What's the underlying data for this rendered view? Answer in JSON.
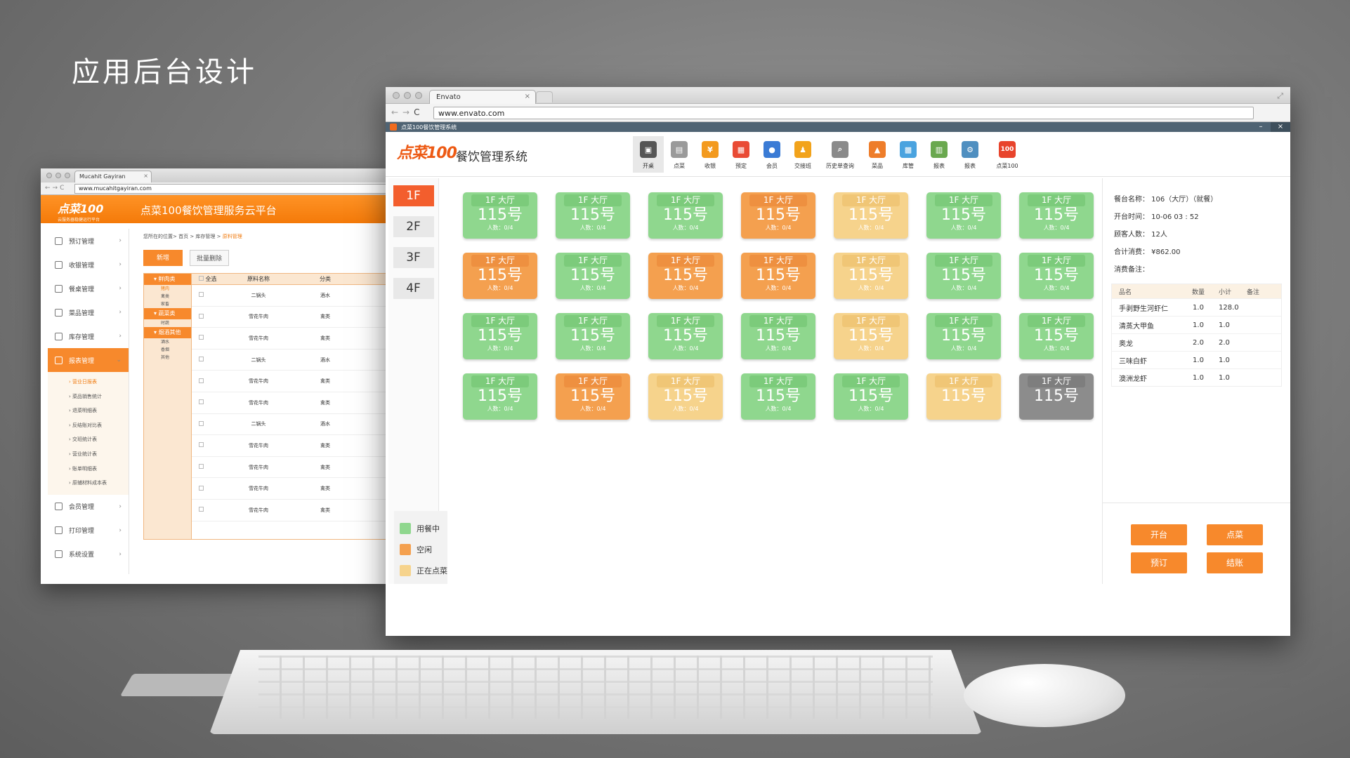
{
  "headline": "应用后台设计",
  "back": {
    "tab_title": "Mucahit Gayiran",
    "url": "www.mucahitgayiran.com",
    "logo": "点菜100",
    "logo_sub": "云服务器稳健运行平台",
    "title": "点菜100餐饮管理服务云平台",
    "nav": [
      "预订管理",
      "收银管理",
      "餐桌管理",
      "菜品管理",
      "库存管理",
      "报表管理",
      "会员管理",
      "打印管理",
      "系统设置"
    ],
    "active_nav": "报表管理",
    "subnav": [
      "营业日报表",
      "菜品销售统计",
      "退菜明细表",
      "反结账对比表",
      "交班统计表",
      "营业统计表",
      "账单明细表",
      "原辅材料成本表"
    ],
    "breadcrumb": "您所在的位置> 首页 > 库存管理 >",
    "breadcrumb_current": "原料管理",
    "btn_add": "新增",
    "btn_batch_delete": "批量删除",
    "categories": [
      {
        "title": "鲜肉类",
        "items": [
          "猪肉",
          "禽类",
          "家畜"
        ]
      },
      {
        "title": "蔬菜类",
        "items": [
          "时蔬"
        ]
      },
      {
        "title": "烟酒其他",
        "items": [
          "酒水",
          "香烟",
          "其他"
        ]
      }
    ],
    "columns": [
      "全选",
      "原料名称",
      "分类"
    ],
    "rows": [
      [
        "二锅头",
        "酒水"
      ],
      [
        "雪花牛肉",
        "禽类"
      ],
      [
        "雪花牛肉",
        "禽类"
      ],
      [
        "二锅头",
        "酒水"
      ],
      [
        "雪花牛肉",
        "禽类"
      ],
      [
        "雪花牛肉",
        "禽类"
      ],
      [
        "二锅头",
        "酒水"
      ],
      [
        "雪花牛肉",
        "禽类"
      ],
      [
        "雪花牛肉",
        "禽类"
      ],
      [
        "雪花牛肉",
        "禽类"
      ],
      [
        "雪花牛肉",
        "禽类"
      ]
    ]
  },
  "front": {
    "tab_title": "Envato",
    "url": "www.envato.com",
    "app_title": "点菜100餐饮管理系统",
    "logo": "点菜100",
    "system_name": "餐饮管理系统",
    "toolbar": [
      {
        "label": "开桌",
        "icon": "table-icon",
        "color": "#555555"
      },
      {
        "label": "点菜",
        "icon": "menu-doc-icon",
        "color": "#9a9a9a"
      },
      {
        "label": "收银",
        "icon": "yen-coin-icon",
        "color": "#f39a1e"
      },
      {
        "label": "预定",
        "icon": "calendar-icon",
        "color": "#e94b35"
      },
      {
        "label": "会员",
        "icon": "member-icon",
        "color": "#3a7bd5"
      },
      {
        "label": "交接班",
        "icon": "handover-icon",
        "color": "#f2a31b"
      },
      {
        "label": "历史单查询",
        "icon": "history-search-icon",
        "color": "#8a8a8a"
      },
      {
        "label": "菜品",
        "icon": "dish-icon",
        "color": "#ee7d2a"
      },
      {
        "label": "库管",
        "icon": "inventory-icon",
        "color": "#4aa3df"
      },
      {
        "label": "报表",
        "icon": "report-chart-icon",
        "color": "#6aa84f"
      },
      {
        "label": "报表",
        "icon": "gear-icon",
        "color": "#4f8fc0"
      },
      {
        "label": "点菜100",
        "icon": "brand-100-icon",
        "color": "#e8442c"
      }
    ],
    "floors": [
      "1F",
      "2F",
      "3F",
      "4F"
    ],
    "active_floor": "1F",
    "tables": [
      {
        "name": "1F 大厅",
        "number": "115号",
        "people": "人数：0/4",
        "status": "green"
      },
      {
        "name": "1F 大厅",
        "number": "115号",
        "people": "人数：0/4",
        "status": "green"
      },
      {
        "name": "1F 大厅",
        "number": "115号",
        "people": "人数：0/4",
        "status": "green"
      },
      {
        "name": "1F 大厅",
        "number": "115号",
        "people": "人数：0/4",
        "status": "orange"
      },
      {
        "name": "1F 大厅",
        "number": "115号",
        "people": "人数：0/4",
        "status": "yellow"
      },
      {
        "name": "1F 大厅",
        "number": "115号",
        "people": "人数：0/4",
        "status": "green"
      },
      {
        "name": "1F 大厅",
        "number": "115号",
        "people": "人数：0/4",
        "status": "green"
      },
      {
        "name": "1F 大厅",
        "number": "115号",
        "people": "人数：0/4",
        "status": "orange"
      },
      {
        "name": "1F 大厅",
        "number": "115号",
        "people": "人数：0/4",
        "status": "green"
      },
      {
        "name": "1F 大厅",
        "number": "115号",
        "people": "人数：0/4",
        "status": "orange"
      },
      {
        "name": "1F 大厅",
        "number": "115号",
        "people": "人数：0/4",
        "status": "orange"
      },
      {
        "name": "1F 大厅",
        "number": "115号",
        "people": "人数：0/4",
        "status": "yellow"
      },
      {
        "name": "1F 大厅",
        "number": "115号",
        "people": "人数：0/4",
        "status": "green"
      },
      {
        "name": "1F 大厅",
        "number": "115号",
        "people": "人数：0/4",
        "status": "green"
      },
      {
        "name": "1F 大厅",
        "number": "115号",
        "people": "人数：0/4",
        "status": "green"
      },
      {
        "name": "1F 大厅",
        "number": "115号",
        "people": "人数：0/4",
        "status": "green"
      },
      {
        "name": "1F 大厅",
        "number": "115号",
        "people": "人数：0/4",
        "status": "green"
      },
      {
        "name": "1F 大厅",
        "number": "115号",
        "people": "人数：0/4",
        "status": "green"
      },
      {
        "name": "1F 大厅",
        "number": "115号",
        "people": "人数：0/4",
        "status": "yellow"
      },
      {
        "name": "1F 大厅",
        "number": "115号",
        "people": "人数：0/4",
        "status": "green"
      },
      {
        "name": "1F 大厅",
        "number": "115号",
        "people": "人数：0/4",
        "status": "green"
      },
      {
        "name": "1F 大厅",
        "number": "115号",
        "people": "人数：0/4",
        "status": "green"
      },
      {
        "name": "1F 大厅",
        "number": "115号",
        "people": "人数：0/4",
        "status": "orange"
      },
      {
        "name": "1F 大厅",
        "number": "115号",
        "people": "人数：0/4",
        "status": "yellow"
      },
      {
        "name": "1F 大厅",
        "number": "115号",
        "people": "人数：0/4",
        "status": "green"
      },
      {
        "name": "1F 大厅",
        "number": "115号",
        "people": "人数：0/4",
        "status": "green"
      },
      {
        "name": "1F 大厅",
        "number": "115号",
        "people": "",
        "status": "yellow"
      },
      {
        "name": "1F 大厅",
        "number": "115号",
        "people": "",
        "status": "gray"
      }
    ],
    "legend": [
      {
        "label": "用餐中",
        "color": "#8fd78e"
      },
      {
        "label": "空闲",
        "color": "#f4a04f"
      },
      {
        "label": "正在点菜",
        "color": "#f6d38c"
      }
    ],
    "info": {
      "table_name": "餐台名称： 106（大厅）（就餐）",
      "open_time": "开台时间： 10-06   03 : 52",
      "guests": "顾客人数： 12人",
      "total": "合计消费： ¥862.00",
      "note": "消费备注："
    },
    "order_columns": [
      "品名",
      "数量",
      "小计",
      "备注"
    ],
    "order_rows": [
      [
        "手剥野生河虾仁",
        "1.0",
        "128.0",
        ""
      ],
      [
        "清蒸大甲鱼",
        "1.0",
        "1.0",
        ""
      ],
      [
        "奥龙",
        "2.0",
        "2.0",
        ""
      ],
      [
        "三味白虾",
        "1.0",
        "1.0",
        ""
      ],
      [
        "澳洲龙虾",
        "1.0",
        "1.0",
        ""
      ]
    ],
    "actions": {
      "open": "开台",
      "order": "点菜",
      "reserve": "预订",
      "checkout": "结账"
    }
  }
}
